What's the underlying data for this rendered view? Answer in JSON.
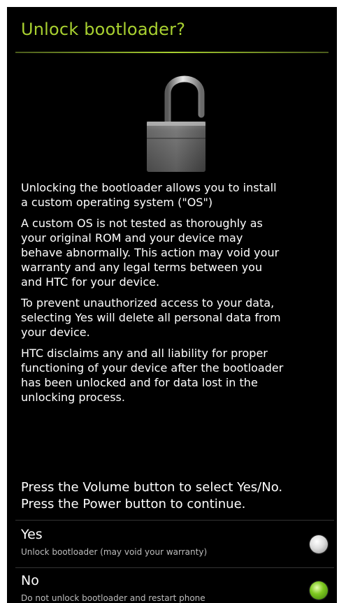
{
  "dialog": {
    "title": "Unlock bootloader?",
    "lock_icon": "unlocked-padlock-icon",
    "paragraphs": [
      "Unlocking the bootloader allows you to  install\na custom operating system (\"OS\")",
      "A custom OS is not tested as thoroughly as\nyour original ROM and your device may\nbehave abnormally. This action may void your\nwarranty and any legal terms between you\nand HTC for your device.",
      "To prevent unauthorized access to your data,\nselecting Yes will delete all personal data from\nyour device.",
      "HTC disclaims any and all liability for proper\nfunctioning of your device after the bootloader\nhas been unlocked and for data lost in the\nunlocking process."
    ],
    "instructions": "Press the Volume button to select Yes/No.\nPress the Power button to continue."
  },
  "options": [
    {
      "label": "Yes",
      "sublabel": "Unlock bootloader (may void your warranty)",
      "selected": false
    },
    {
      "label": "No",
      "sublabel": "Do not unlock bootloader and restart phone",
      "selected": true
    }
  ],
  "colors": {
    "background": "#000000",
    "title": "#a8d030",
    "text": "#ffffff",
    "radio_selected": "#7ec820"
  }
}
